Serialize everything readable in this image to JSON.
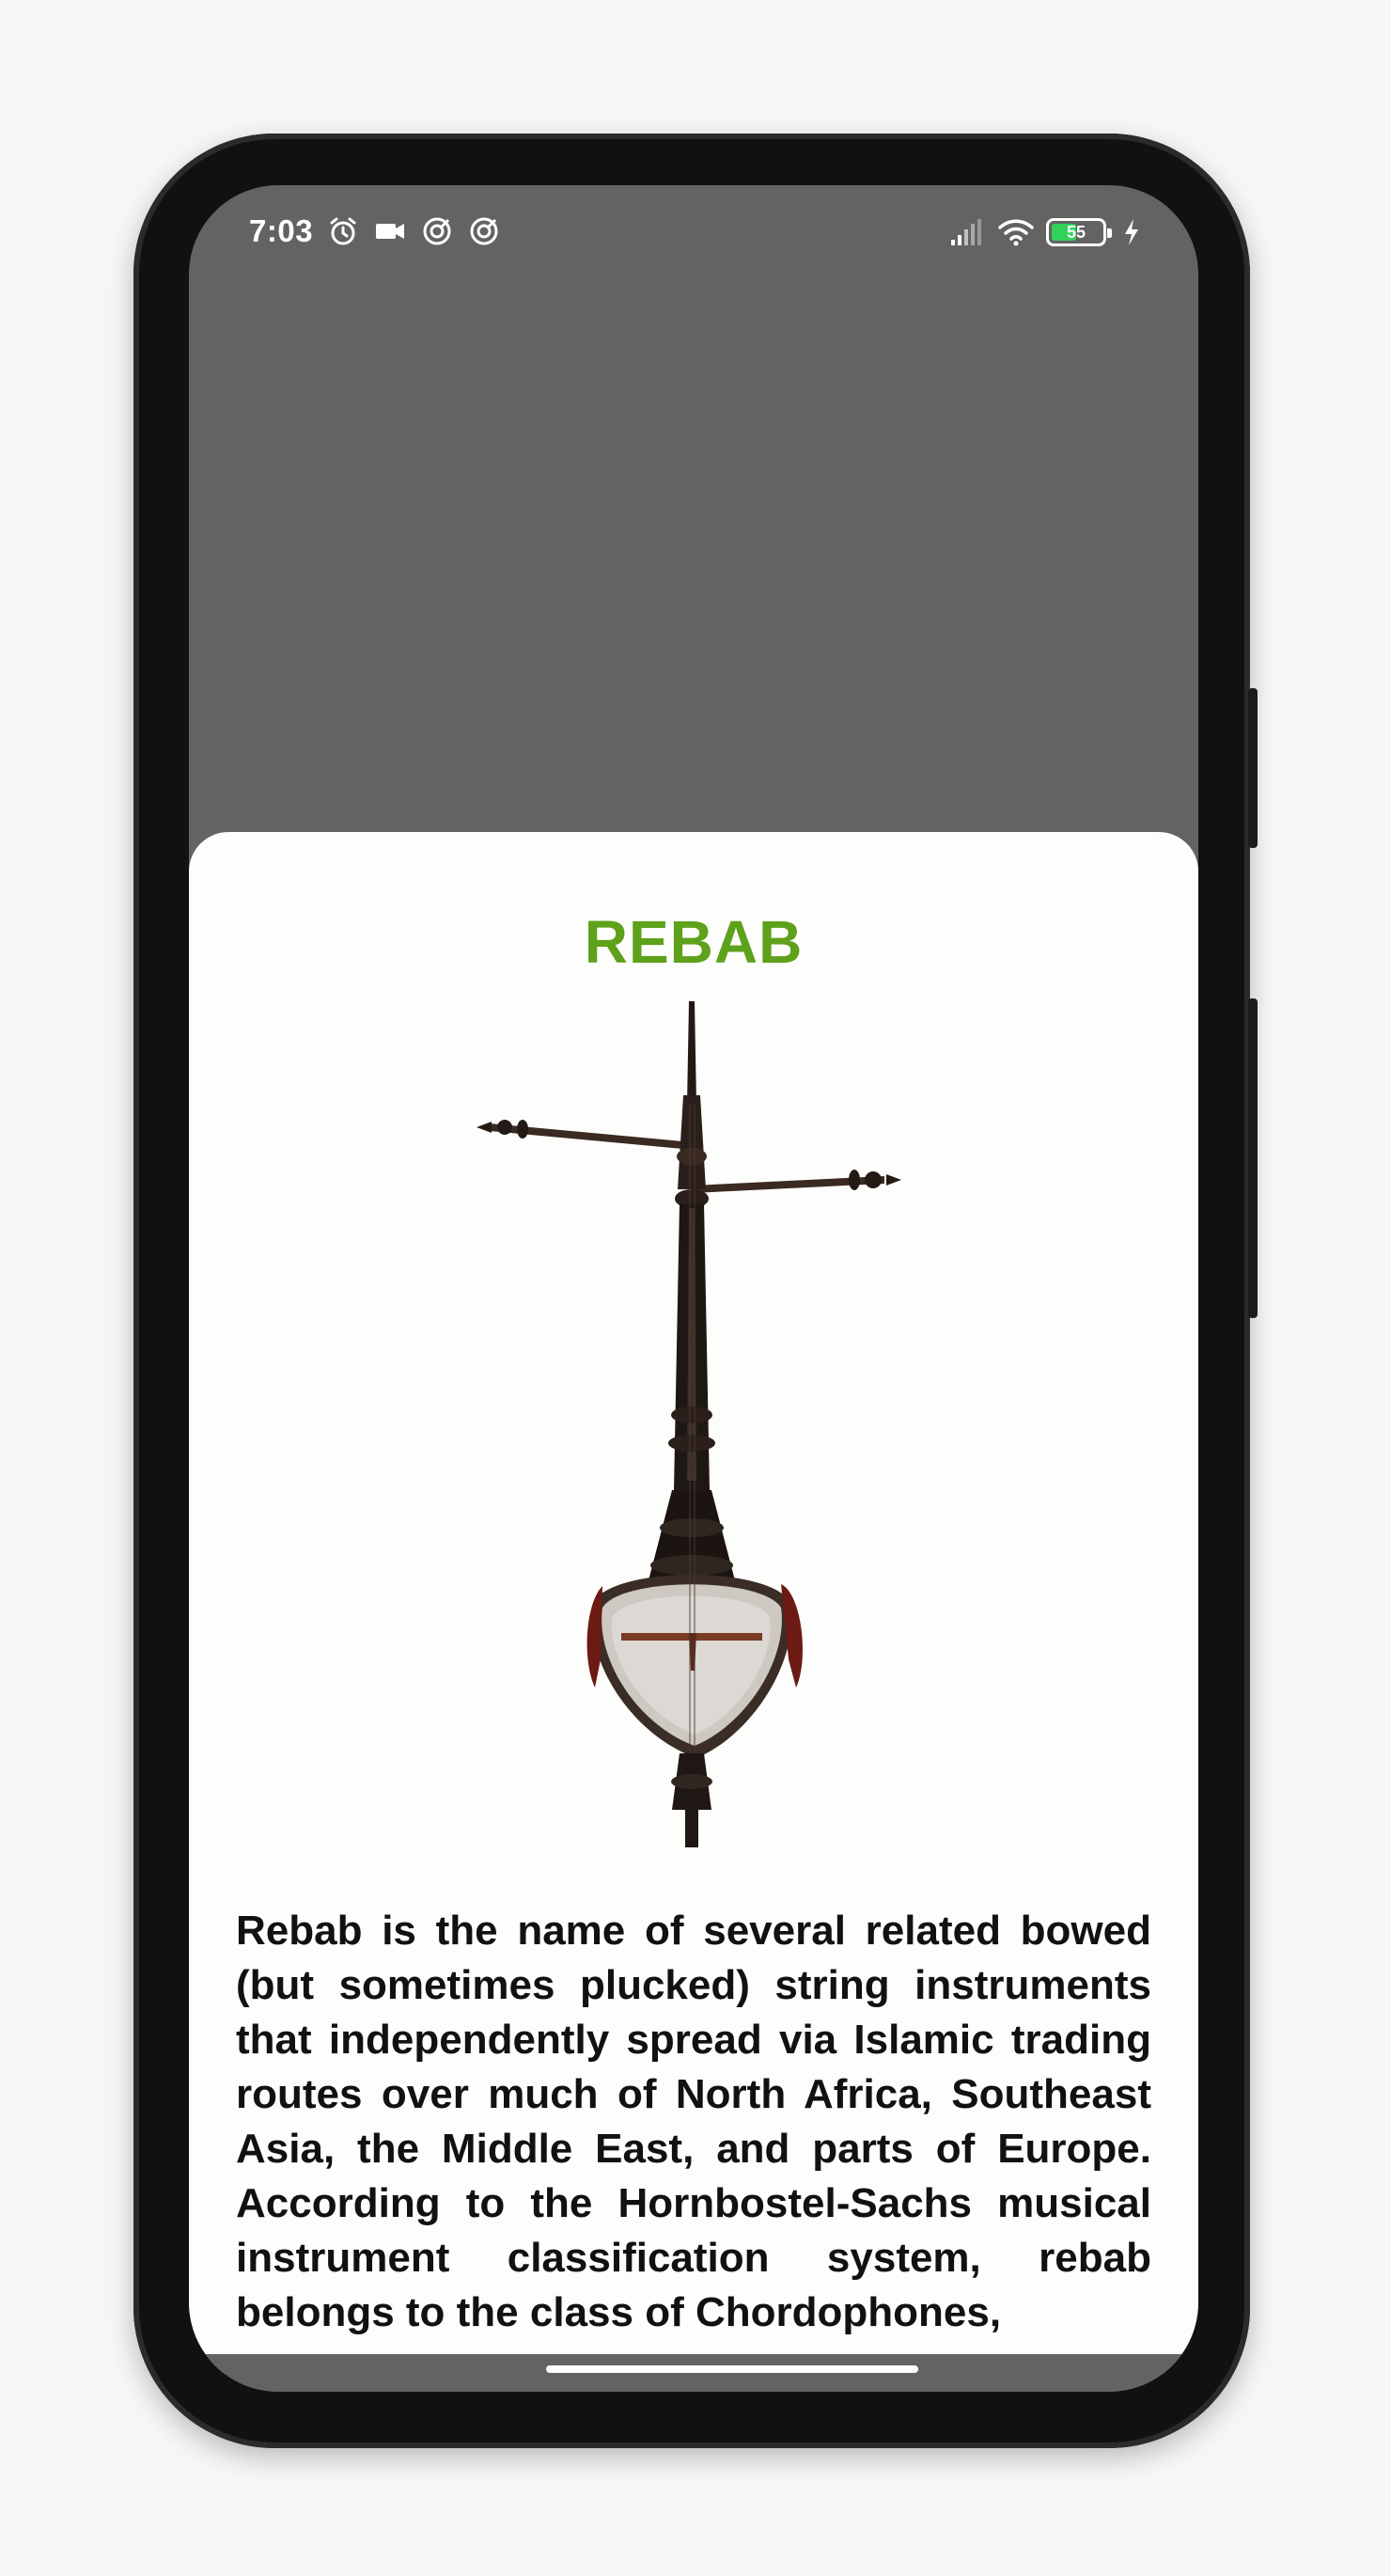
{
  "status_bar": {
    "time": "7:03",
    "icons_left": [
      "alarm-icon",
      "video-camera-icon",
      "sync-icon",
      "sync-icon"
    ],
    "icons_right": [
      "signal-icon",
      "wifi-icon",
      "battery-icon",
      "charging-icon"
    ],
    "battery_level": "55"
  },
  "card": {
    "title": "REBAB",
    "image_alt": "rebab-instrument-image",
    "description": "Rebab  is the name of several related bowed (but sometimes plucked) string instruments that independently spread via Islamic trading routes over much of North Africa, Southeast Asia, the Middle East, and parts of Europe. According to the Hornbostel-Sachs musical instrument classification system, rebab belongs to the class of Chordophones,"
  },
  "colors": {
    "header_background": "#636462",
    "card_background": "#fdfefc",
    "title_color": "#5ea11a",
    "battery_fill": "#2fd35a"
  }
}
